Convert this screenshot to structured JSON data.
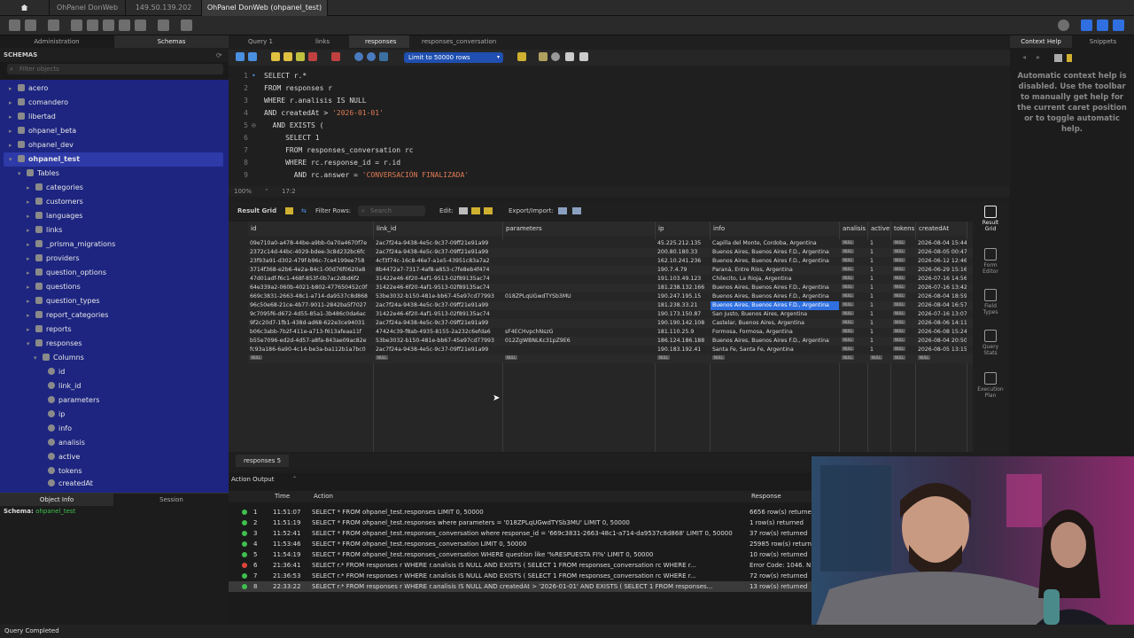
{
  "titlebar": {
    "tabs": [
      "OhPanel DonWeb",
      "149.50.139.202",
      "OhPanel DonWeb (ohpanel_test)"
    ]
  },
  "left": {
    "tabs": [
      "Administration",
      "Schemas"
    ],
    "header": "SCHEMAS",
    "filter_placeholder": "Filter objects",
    "schemas": [
      "acero",
      "comandero",
      "libertad",
      "ohpanel_beta",
      "ohpanel_dev",
      "ohpanel_test"
    ],
    "tables_label": "Tables",
    "tables": [
      "categories",
      "customers",
      "languages",
      "links",
      "_prisma_migrations",
      "providers",
      "question_options",
      "questions",
      "question_types",
      "report_categories",
      "reports",
      "responses"
    ],
    "columns_label": "Columns",
    "columns": [
      "id",
      "link_id",
      "parameters",
      "ip",
      "info",
      "analisis",
      "active",
      "tokens",
      "createdAt"
    ],
    "bottom_tabs": [
      "Object Info",
      "Session"
    ],
    "schema_label": "Schema:",
    "schema_value": "ohpanel_test"
  },
  "editor": {
    "tabs": [
      "Query 1",
      "links",
      "responses",
      "responses_conversation"
    ],
    "limit": "Limit to 50000 rows",
    "lines": [
      {
        "n": "1",
        "t": "SELECT r.*",
        "s": ""
      },
      {
        "n": "2",
        "t": "FROM responses r",
        "s": ""
      },
      {
        "n": "3",
        "t": "WHERE r.analisis IS NULL",
        "s": ""
      },
      {
        "n": "4",
        "t": "AND createdAt > ",
        "s": "'2026-01-01'"
      },
      {
        "n": "5",
        "t": "  AND EXISTS (",
        "s": ""
      },
      {
        "n": "6",
        "t": "     SELECT 1",
        "s": ""
      },
      {
        "n": "7",
        "t": "     FROM responses_conversation rc",
        "s": ""
      },
      {
        "n": "8",
        "t": "     WHERE rc.response_id = r.id",
        "s": ""
      },
      {
        "n": "9",
        "t": "       AND rc.answer = ",
        "s": "'CONVERSACIÓN FINALIZADA'"
      }
    ],
    "zoom": "100%",
    "pos": "17:2"
  },
  "grid_toolbar": {
    "result_grid": "Result Grid",
    "filter_rows": "Filter Rows:",
    "search_placeholder": "Search",
    "edit": "Edit:",
    "export": "Export/Import:"
  },
  "grid": {
    "columns": [
      "id",
      "link_id",
      "parameters",
      "ip",
      "info",
      "analisis",
      "active",
      "tokens",
      "createdAt"
    ],
    "rows": [
      [
        "09e710a0-a478-44be-a9bb-0a70a4670f7e",
        "2ac7f24a-9438-4e5c-9c37-09ff21e91a99",
        "",
        "45.225.212.135",
        "Capilla del Monte, Cordoba, Argentina",
        "NULL",
        "1",
        "NULL",
        "2026-08-04 15:44"
      ],
      [
        "2372c14d-44bc-4029-bdee-3c8d232bc6fc",
        "2ac7f24a-9438-4e5c-9c37-09ff21e91a99",
        "",
        "200.80.180.33",
        "Buenos Aires, Buenos Aires F.D., Argentina",
        "NULL",
        "1",
        "NULL",
        "2026-08-05 00:47"
      ],
      [
        "23f93a91-d302-479f-b96c-7ce4199ee758",
        "4cf3f74c-16c8-46e7-a1e5-43951c83a7a2",
        "",
        "162.10.241.236",
        "Buenos Aires, Buenos Aires F.D., Argentina",
        "NULL",
        "1",
        "NULL",
        "2026-06-12 12:46"
      ],
      [
        "3714f368-e2b6-4e2a-84c1-00d76f0620a8",
        "8b4472a7-7317-4af8-a853-c7fe8eb4f474",
        "",
        "190.7.4.79",
        "Paraná, Entre Ríos, Argentina",
        "NULL",
        "1",
        "NULL",
        "2026-06-29 15:16"
      ],
      [
        "47d01adf-f6c1-468f-853f-0b7ac2dbd6f2",
        "31422e46-6f20-4af1-9513-02f89135ac74",
        "",
        "191.103.49.123",
        "Chilecito, La Rioja, Argentina",
        "NULL",
        "1",
        "NULL",
        "2026-07-16 14:56"
      ],
      [
        "64e339a2-060b-4021-b802-477650452c0f",
        "31422e46-6f20-4af1-9513-02f89135ac74",
        "",
        "181.238.132.166",
        "Buenos Aires, Buenos Aires F.D., Argentina",
        "NULL",
        "1",
        "NULL",
        "2026-07-16 13:42"
      ],
      [
        "669c3831-2663-48c1-a714-da9537c8d868",
        "53be3032-b150-481e-bb67-45e97cd77993",
        "018ZPLqUGwdTYSb3MU",
        "190.247.195.15",
        "Buenos Aires, Buenos Aires F.D., Argentina",
        "NULL",
        "1",
        "NULL",
        "2026-08-04 18:59"
      ],
      [
        "96c50e68-21ce-4b77-9011-2842ba5f7027",
        "2ac7f24a-9438-4e5c-9c37-09ff21e91a99",
        "",
        "181.238.33.21",
        "Buenos Aires, Buenos Aires F.D., Argentina",
        "NULL",
        "1",
        "NULL",
        "2026-08-04 16:57"
      ],
      [
        "9c7095f6-d672-4d55-85a1-3b486c0da6ac",
        "31422e46-6f20-4af1-9513-02f89135ac74",
        "",
        "190.173.150.87",
        "San Justo, Buenos Aires, Argentina",
        "NULL",
        "1",
        "NULL",
        "2026-07-16 13:07"
      ],
      [
        "9f2c20d7-1fb1-438d-ad68-622e3ce94031",
        "2ac7f24a-9438-4e5c-9c37-09ff21e91a99",
        "",
        "190.190.142.108",
        "Castelar, Buenos Aires, Argentina",
        "NULL",
        "1",
        "NULL",
        "2026-08-06 14:11"
      ],
      [
        "b06c3abb-7b2f-411e-a713-f613afeaa11f",
        "47424c39-f8ab-4935-8155-2a232c6efda6",
        "sF4ECHvpchNszG",
        "181.110.25.9",
        "Formosa, Formosa, Argentina",
        "NULL",
        "1",
        "NULL",
        "2026-06-08 15:24"
      ],
      [
        "b55e7096-ed2d-4d57-a8fa-843ae09ac82e",
        "53be3032-b150-481e-bb67-45e97cd77993",
        "012ZgWBNLKc31pZ9E6",
        "186.124.186.188",
        "Buenos Aires, Buenos Aires F.D., Argentina",
        "NULL",
        "1",
        "NULL",
        "2026-08-04 20:50"
      ],
      [
        "fc93a186-6a90-4c14-be3a-ba112b1a7bc0",
        "2ac7f24a-9438-4e5c-9c37-09ff21e91a99",
        "",
        "190.183.192.41",
        "Santa Fe, Santa Fe, Argentina",
        "NULL",
        "1",
        "NULL",
        "2026-08-05 13:15"
      ],
      [
        "NULL",
        "NULL",
        "NULL",
        "NULL",
        "NULL",
        "NULL",
        "NULL",
        "NULL",
        "NULL"
      ]
    ]
  },
  "right": {
    "tabs": [
      "Context Help",
      "Snippets"
    ],
    "help": "Automatic context help is disabled. Use the toolbar to manually get help for the current caret position or to toggle automatic help."
  },
  "side_buttons": [
    "Result Grid",
    "Form Editor",
    "Field Types",
    "Query Stats",
    "Execution Plan"
  ],
  "result_tab": "responses 5",
  "output": {
    "label": "Action Output",
    "headers": [
      "Time",
      "Action",
      "Response"
    ],
    "rows": [
      {
        "status": "ok",
        "n": "1",
        "time": "11:51:07",
        "action": "SELECT * FROM ohpanel_test.responses LIMIT 0, 50000",
        "response": "6656 row(s) returned"
      },
      {
        "status": "ok",
        "n": "2",
        "time": "11:51:19",
        "action": "SELECT * FROM ohpanel_test.responses where parameters = '018ZPLqUGwdTYSb3MU' LIMIT 0, 50000",
        "response": "1 row(s) returned"
      },
      {
        "status": "ok",
        "n": "3",
        "time": "11:52:41",
        "action": "SELECT * FROM ohpanel_test.responses_conversation where response_id = '669c3831-2663-48c1-a714-da9537c8d868' LIMIT 0, 50000",
        "response": "37 row(s) returned"
      },
      {
        "status": "ok",
        "n": "4",
        "time": "11:53:46",
        "action": "SELECT * FROM ohpanel_test.responses_conversation LIMIT 0, 50000",
        "response": "25985 row(s) return"
      },
      {
        "status": "ok",
        "n": "5",
        "time": "11:54:19",
        "action": "SELECT * FROM ohpanel_test.responses_conversation WHERE question like '%RESPUESTA FI%' LIMIT 0, 50000",
        "response": "10 row(s) returned"
      },
      {
        "status": "err",
        "n": "6",
        "time": "21:36:41",
        "action": "SELECT r.* FROM responses r  WHERE r.analisis IS NULL   AND EXISTS (      SELECT 1       FROM responses_conversation rc       WHERE r...",
        "response": "Error Code: 1046. N"
      },
      {
        "status": "ok",
        "n": "7",
        "time": "21:36:53",
        "action": "SELECT r.* FROM responses r  WHERE r.analisis IS NULL   AND EXISTS (      SELECT 1       FROM responses_conversation rc       WHERE r...",
        "response": "72 row(s) returned"
      },
      {
        "status": "ok",
        "n": "8",
        "time": "22:33:22",
        "action": "SELECT r.* FROM responses r WHERE r.analisis IS NULL AND createdAt > '2026-01-01'   AND EXISTS (      SELECT 1       FROM responses...",
        "response": "13 row(s) returned"
      }
    ]
  },
  "status": "Query Completed",
  "colors": {
    "sidebar_blue": "#202a8f",
    "accent": "#2f6fe0",
    "ok": "#3fbf4f",
    "err": "#e0443a",
    "string": "#e07b55"
  }
}
